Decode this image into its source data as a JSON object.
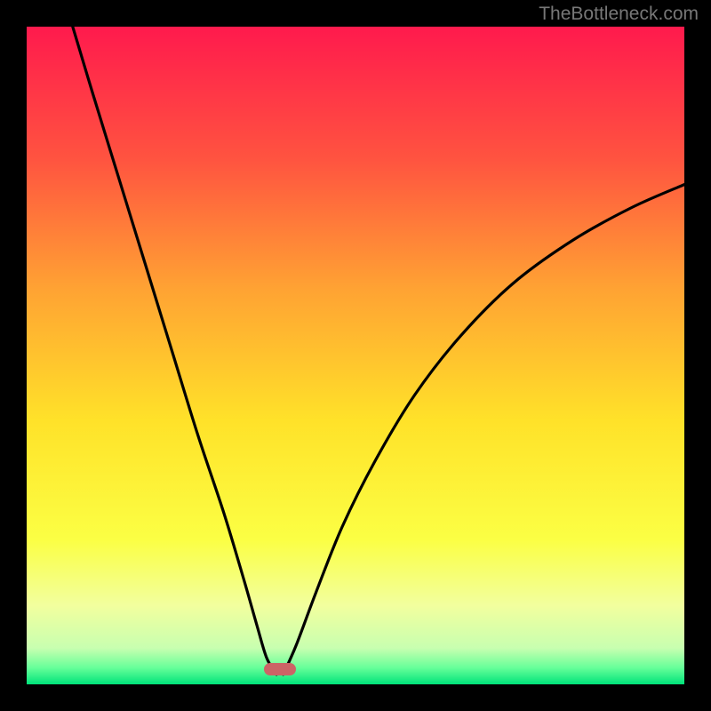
{
  "watermark": "TheBottleneck.com",
  "chart_data": {
    "type": "line",
    "title": "",
    "xlabel": "",
    "ylabel": "",
    "xlim": [
      0,
      100
    ],
    "ylim": [
      0,
      100
    ],
    "grid": false,
    "legend": false,
    "gradient_stops": [
      {
        "offset": 0.0,
        "color": "#ff1a4d"
      },
      {
        "offset": 0.2,
        "color": "#ff5340"
      },
      {
        "offset": 0.4,
        "color": "#ffa333"
      },
      {
        "offset": 0.6,
        "color": "#ffe229"
      },
      {
        "offset": 0.78,
        "color": "#fbff44"
      },
      {
        "offset": 0.88,
        "color": "#f2ff9e"
      },
      {
        "offset": 0.945,
        "color": "#c8ffb0"
      },
      {
        "offset": 0.975,
        "color": "#66ff99"
      },
      {
        "offset": 1.0,
        "color": "#00e37a"
      }
    ],
    "marker": {
      "x": 38.5,
      "y": 2.3
    },
    "series": [
      {
        "name": "left-branch",
        "x": [
          7.0,
          10,
          14,
          18,
          22,
          26,
          30,
          33,
          35,
          36.5,
          38
        ],
        "y": [
          100,
          90,
          77,
          64,
          51,
          38,
          26,
          16,
          9,
          4,
          1.5
        ]
      },
      {
        "name": "right-branch",
        "x": [
          39,
          41,
          44,
          48,
          53,
          59,
          66,
          74,
          83,
          92,
          100
        ],
        "y": [
          1.5,
          6,
          14,
          24,
          34,
          44,
          53,
          61,
          67.5,
          72.5,
          76
        ]
      }
    ]
  }
}
